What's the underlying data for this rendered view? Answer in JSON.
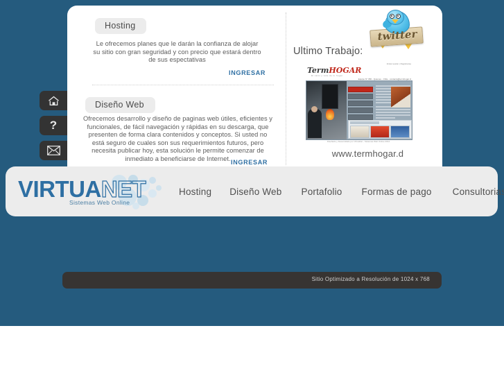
{
  "site": {
    "background_color": "#255b7e",
    "card_color": "#ffffff",
    "nav_color": "#ececec",
    "accent_color": "#2e6fa3",
    "footer_color": "#373432"
  },
  "sidebar": {
    "buttons": [
      {
        "name": "home",
        "icon": "home-icon",
        "label": ""
      },
      {
        "name": "help",
        "icon": "question-mark-icon",
        "label": "?"
      },
      {
        "name": "contact",
        "icon": "envelope-icon",
        "label": ""
      }
    ]
  },
  "content": {
    "sections": [
      {
        "title": "Hosting",
        "body": "Le ofrecemos planes que le darán la confianza de alojar su sitio con gran seguridad y con precio que estará dentro de sus espectativas",
        "cta": "INGRESAR"
      },
      {
        "title": "Diseño Web",
        "body": "Ofrecemos desarrollo y diseño de paginas web útiles, eficientes y funcionales, de fácil navegación y rápidas en su descarga, que presenten de forma clara contenidos y conceptos. Si usted no está seguro de cuales son sus requerimientos futuros, pero necesita publicar hoy, esta solución le permite comenzar de inmediato a beneficiarse de Internet.",
        "cta": "INGRESAR"
      }
    ]
  },
  "showcase": {
    "twitter_label": "twitter",
    "title": "Ultimo Trabajo:",
    "url": "www.termhogar.d",
    "preview": {
      "logo_prefix": "Term",
      "logo_suffix": "HOGAR",
      "logo_tagline": "El calor y vida de tu hogar",
      "top_bar": "Iniciar sesión | Registrarse",
      "menu_strip": "Equipo N° 956  -  Quienes - Chile  -  contacto@termhogar.cl",
      "intro_heading": "Bienvenido a nuestro portal...",
      "nav_items": [
        "INICIO",
        "SERVICIOS",
        "PRODUCTOS",
        "CLIENTES",
        "AREA TECNICA",
        "CONTACTO"
      ],
      "panel_heading": "NUESTROS PRODUCTOS",
      "footer": "Diseñado y Desarrollado por VirtuaNet - Sistemas Web Online 2012"
    }
  },
  "nav": {
    "logo": {
      "part_solid": "VIRTUA",
      "part_outline": "NET",
      "tagline": "Sistemas Web Online"
    },
    "links": [
      {
        "label": "Hosting"
      },
      {
        "label": "Diseño Web"
      },
      {
        "label": "Portafolio"
      },
      {
        "label": "Formas de pago"
      },
      {
        "label": "Consultorias T.I."
      }
    ]
  },
  "footer": {
    "note": "Sitio Optimizado a Resolución  de 1024 x 768"
  }
}
